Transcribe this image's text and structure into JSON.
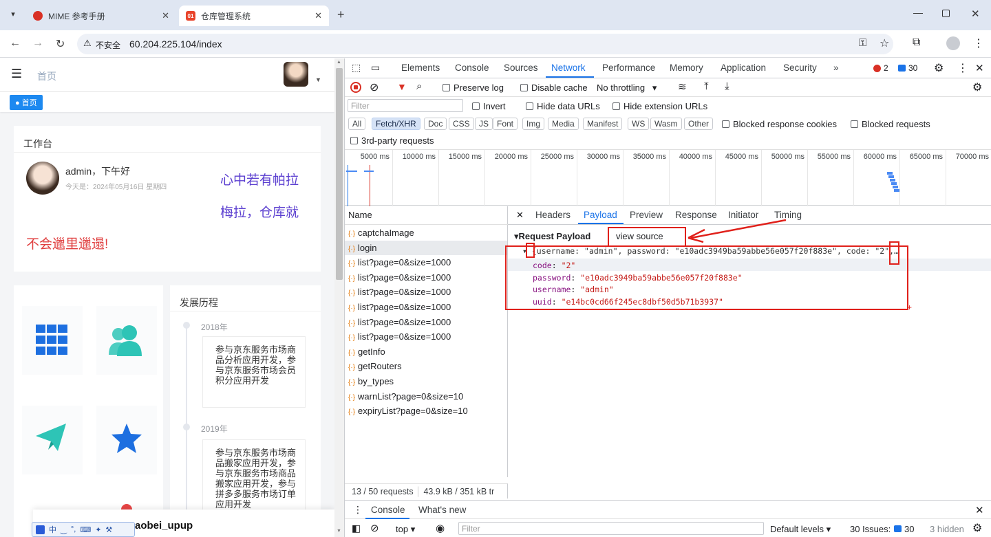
{
  "browser": {
    "tabs": [
      {
        "title": "MIME 参考手册",
        "active": false
      },
      {
        "title": "仓库管理系统",
        "active": true
      }
    ],
    "security_label": "不安全",
    "url": "60.204.225.104/index"
  },
  "app": {
    "breadcrumb": "首页",
    "tag": "首页",
    "workbench": {
      "title": "工作台",
      "greeting": "admin，下午好",
      "date": "今天是：2024年05月16日 星期四",
      "slogan_line1": "心中若有帕拉",
      "slogan_line2": "梅拉，仓库就",
      "slogan_line3": "不会邋里邋遢!"
    },
    "history": {
      "title": "发展历程",
      "items": [
        {
          "year": "2018年",
          "text": "参与京东服务市场商品分析应用开发，参与京东服务市场会员积分应用开发"
        },
        {
          "year": "2019年",
          "text": "参与京东服务市场商品搬家应用开发，参与京东服务市场商品搬家应用开发，参与拼多多服务市场订单应用开发"
        }
      ]
    },
    "taskbar_text": "aobei_upup",
    "ime_items": [
      "中",
      "‿",
      "°,",
      "⌨",
      "✦",
      "⚒"
    ]
  },
  "devtools": {
    "tabs": [
      "Elements",
      "Console",
      "Sources",
      "Network",
      "Performance",
      "Memory",
      "Application",
      "Security"
    ],
    "active_tab": "Network",
    "errors": "2",
    "messages": "30",
    "toolbar": {
      "preserve_log": "Preserve log",
      "disable_cache": "Disable cache",
      "throttling": "No throttling"
    },
    "filter_placeholder": "Filter",
    "invert": "Invert",
    "hide_data": "Hide data URLs",
    "hide_ext": "Hide extension URLs",
    "types": [
      "All",
      "Fetch/XHR",
      "Doc",
      "CSS",
      "JS",
      "Font",
      "Img",
      "Media",
      "Manifest",
      "WS",
      "Wasm",
      "Other"
    ],
    "blocked_cookies": "Blocked response cookies",
    "blocked_requests": "Blocked requests",
    "third_party": "3rd-party requests",
    "timeline_ticks": [
      "5000 ms",
      "10000 ms",
      "15000 ms",
      "20000 ms",
      "25000 ms",
      "30000 ms",
      "35000 ms",
      "40000 ms",
      "45000 ms",
      "50000 ms",
      "55000 ms",
      "60000 ms",
      "65000 ms",
      "70000 ms"
    ],
    "name_header": "Name",
    "requests": [
      "captchaImage",
      "login",
      "list?page=0&size=1000",
      "list?page=0&size=1000",
      "list?page=0&size=1000",
      "list?page=0&size=1000",
      "list?page=0&size=1000",
      "list?page=0&size=1000",
      "getInfo",
      "getRouters",
      "by_types",
      "warnList?page=0&size=10",
      "expiryList?page=0&size=10"
    ],
    "selected_request": "login",
    "status_requests": "13 / 50 requests",
    "status_size": "43.9 kB / 351 kB tr",
    "detail_tabs": [
      "Headers",
      "Payload",
      "Preview",
      "Response",
      "Initiator",
      "Timing"
    ],
    "active_detail_tab": "Payload",
    "payload": {
      "section_title": "Request Payload",
      "view_source": "view source",
      "summary": "{username: \"admin\", password: \"e10adc3949ba59abbe56e057f20f883e\", code: \"2\",…}",
      "fields": [
        {
          "key": "code",
          "value": "\"2\""
        },
        {
          "key": "password",
          "value": "\"e10adc3949ba59abbe56e057f20f883e\""
        },
        {
          "key": "username",
          "value": "\"admin\""
        },
        {
          "key": "uuid",
          "value": "\"e14bc0cd66f245ec8dbf50d5b71b3937\""
        }
      ]
    },
    "drawer": {
      "tabs": [
        "Console",
        "What's new"
      ],
      "context": "top",
      "filter_placeholder": "Filter",
      "levels": "Default levels ▾",
      "issues": "30 Issues:",
      "issues_count": "30",
      "hidden": "3 hidden"
    }
  },
  "colors": {
    "accent": "#1a73e8",
    "annotation": "#e0201a",
    "purple": "#5b3fd0",
    "link_blue": "#1d6fe0"
  }
}
